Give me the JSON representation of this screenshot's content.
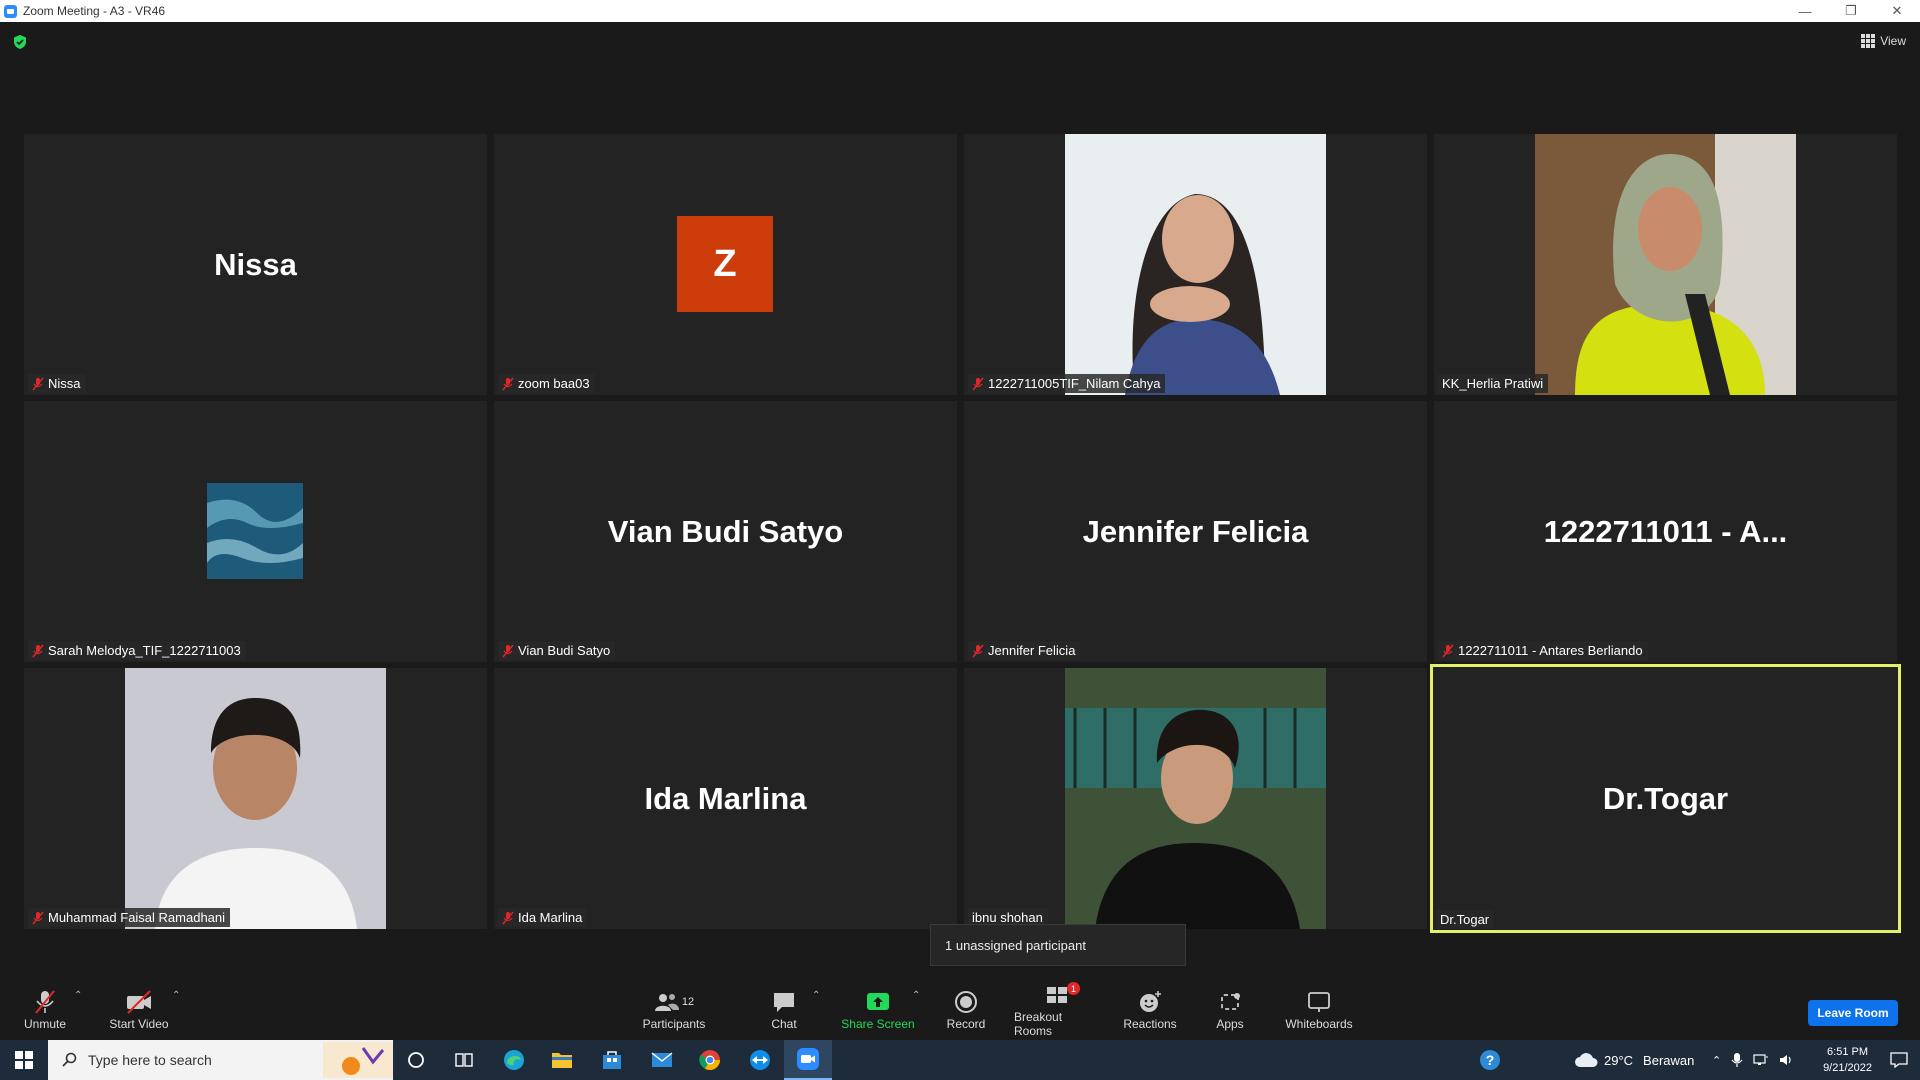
{
  "window": {
    "title": "Zoom Meeting - A3 - VR46"
  },
  "header": {
    "view_label": "View"
  },
  "participants": [
    {
      "display": "Nissa",
      "label": "Nissa",
      "muted": true
    },
    {
      "display": "Z",
      "label": "zoom baa03",
      "muted": true
    },
    {
      "display": "",
      "label": "1222711005TIF_Nilam Cahya",
      "muted": true
    },
    {
      "display": "",
      "label": "KK_Herlia Pratiwi",
      "muted": false
    },
    {
      "display": "",
      "label": "Sarah Melodya_TIF_1222711003",
      "muted": true
    },
    {
      "display": "Vian Budi Satyo",
      "label": "Vian Budi Satyo",
      "muted": true
    },
    {
      "display": "Jennifer Felicia",
      "label": "Jennifer Felicia",
      "muted": true
    },
    {
      "display": "1222711011 - A...",
      "label": "1222711011 - Antares Berliando",
      "muted": true
    },
    {
      "display": "",
      "label": "Muhammad Faisal Ramadhani",
      "muted": true
    },
    {
      "display": "Ida Marlina",
      "label": "Ida Marlina",
      "muted": true
    },
    {
      "display": "",
      "label": "ibnu shohan",
      "muted": false
    },
    {
      "display": "Dr.Togar",
      "label": "Dr.Togar",
      "muted": false
    }
  ],
  "tooltip": {
    "text": "1 unassigned participant"
  },
  "toolbar": {
    "unmute": "Unmute",
    "start_video": "Start Video",
    "participants": "Participants",
    "participants_count": "12",
    "chat": "Chat",
    "share_screen": "Share Screen",
    "record": "Record",
    "breakout_rooms": "Breakout Rooms",
    "breakout_badge": "1",
    "reactions": "Reactions",
    "apps": "Apps",
    "whiteboards": "Whiteboards",
    "leave": "Leave Room"
  },
  "taskbar": {
    "search_placeholder": "Type here to search",
    "weather_temp": "29°C",
    "weather_desc": "Berawan",
    "time": "6:51 PM",
    "date": "9/21/2022"
  },
  "colors": {
    "active_speaker": "#e2f06a",
    "leave_button": "#0e72ed",
    "share_green": "#23d959",
    "avatar_z": "#cc3d0b",
    "mute_red": "#e02828"
  }
}
